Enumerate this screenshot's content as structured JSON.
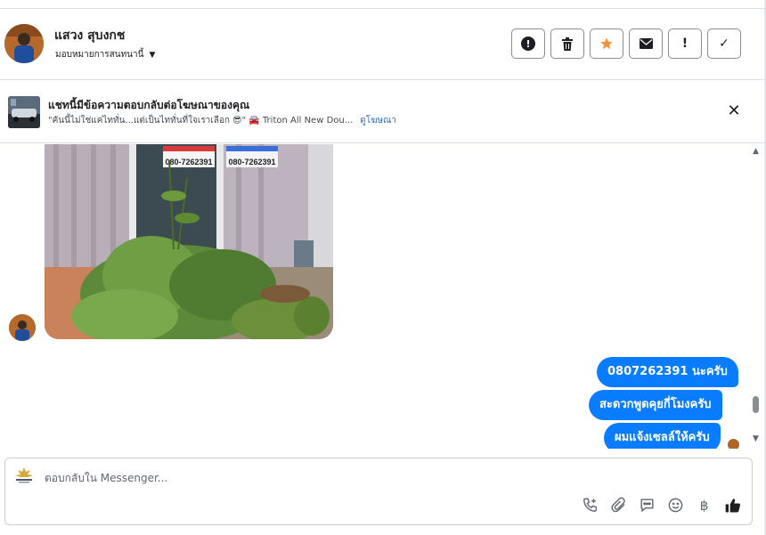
{
  "header": {
    "user_name": "แสวง สุบงกช",
    "assign_label": "มอบหมายการสนทนานี้",
    "actions": [
      {
        "name": "report-spam-button",
        "icon": "circle-exclamation-icon"
      },
      {
        "name": "delete-button",
        "icon": "trash-icon"
      },
      {
        "name": "star-button",
        "icon": "star-icon"
      },
      {
        "name": "mark-unread-button",
        "icon": "envelope-icon"
      },
      {
        "name": "follow-up-button",
        "icon": "exclamation-icon",
        "glyph": "!"
      },
      {
        "name": "mark-done-button",
        "icon": "check-icon",
        "glyph": "✓"
      }
    ]
  },
  "ad_banner": {
    "title": "แชทนี้มีข้อความตอบกลับต่อโฆษณาของคุณ",
    "subtitle": "\"คันนี้ไม่ใช่แค่ไททั่น...แต่เป็นไททั่นที่ใจเราเลือก 😎\" 🚘 Triton All New Dou...",
    "view_ad_link": "ดูโฆษณา",
    "close_glyph": "✕"
  },
  "chat": {
    "photo_signs": [
      "080-7262391",
      "080-7262391"
    ],
    "messages": [
      {
        "text": "0807262391 นะครับ",
        "sender": "page"
      },
      {
        "text": "สะดวกพูดคุยกี่โมงครับ",
        "sender": "page"
      },
      {
        "text": "ผมแจ้งเซลล์ให้ครับ",
        "sender": "page"
      }
    ]
  },
  "composer": {
    "placeholder": "ตอบกลับใน Messenger...",
    "baht_glyph": "฿",
    "tools": [
      "phone-plus-icon",
      "paperclip-icon",
      "saved-reply-icon",
      "emoji-icon",
      "baht-icon",
      "thumbs-up-icon"
    ]
  },
  "colors": {
    "bubble": "#0a7cff",
    "star": "#f7923a",
    "link": "#216fdb",
    "border": "#dadde1"
  }
}
